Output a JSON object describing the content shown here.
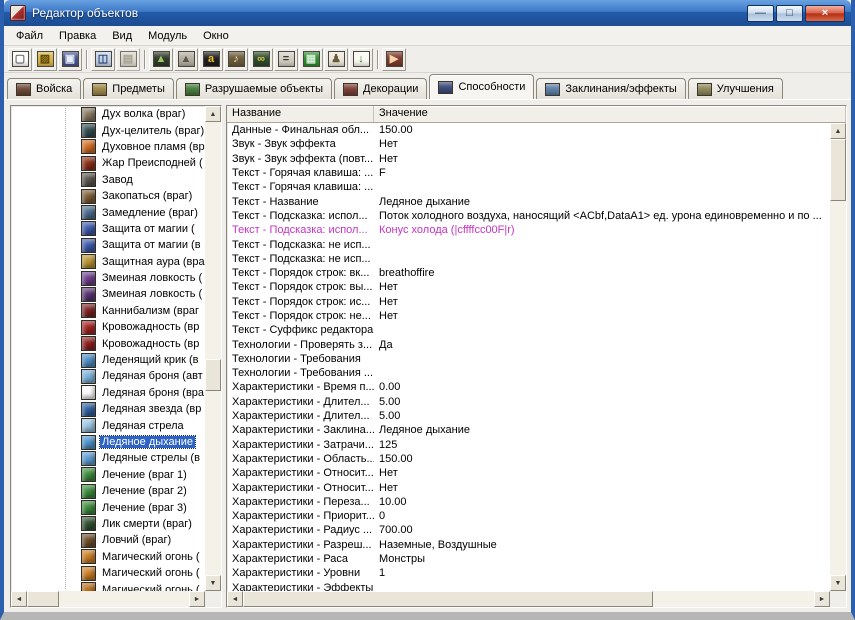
{
  "window": {
    "title": "Редактор объектов"
  },
  "window_buttons": {
    "minimize": "—",
    "maximize": "□",
    "close": "×"
  },
  "scroll_icons": {
    "up": "▲",
    "down": "▼",
    "left": "◄",
    "right": "►"
  },
  "menu": {
    "items": [
      "Файл",
      "Правка",
      "Вид",
      "Модуль",
      "Окно"
    ]
  },
  "toolbar": {
    "buttons": [
      {
        "name": "new-map-button",
        "glyph": "▢",
        "bg": "#ffffff",
        "fg": "#666666"
      },
      {
        "name": "open-map-button",
        "glyph": "▨",
        "bg": "#d8b44a",
        "fg": "#5a4400"
      },
      {
        "name": "save-map-button",
        "glyph": "▣",
        "bg": "#46548c",
        "fg": "#e8eef8"
      },
      {
        "class": "sep"
      },
      {
        "name": "copy-button",
        "glyph": "◫",
        "bg": "#c4d2e6",
        "fg": "#2c4a78"
      },
      {
        "name": "paste-button",
        "glyph": "▤",
        "bg": "#d4cfc0",
        "fg": "#8c8678",
        "class": "disabled"
      },
      {
        "class": "sep"
      },
      {
        "name": "terrain-editor-button",
        "glyph": "▲",
        "bg": "#2e3a28",
        "fg": "#9ec468"
      },
      {
        "name": "doodad-palette-button",
        "glyph": "▲",
        "bg": "#b2aea0",
        "fg": "#5c584c"
      },
      {
        "name": "trigger-editor-button",
        "glyph": "a",
        "bg": "#1e1e1e",
        "fg": "#f0c030"
      },
      {
        "name": "sound-editor-button",
        "glyph": "♪",
        "bg": "#6a5a3a",
        "fg": "#f4e6b0"
      },
      {
        "name": "object-editor-button",
        "glyph": "∞",
        "bg": "#2a4a2a",
        "fg": "#e2c444"
      },
      {
        "name": "object-manager-button",
        "glyph": "=",
        "bg": "#d2cec2",
        "fg": "#3a3a3a"
      },
      {
        "name": "campaign-editor-button",
        "glyph": "▦",
        "bg": "#2e8b2e",
        "fg": "#d2ecd2"
      },
      {
        "name": "ai-editor-button",
        "glyph": "♟",
        "bg": "#ece8dc",
        "fg": "#6a5a38"
      },
      {
        "name": "import-manager-button",
        "glyph": "↓",
        "bg": "#fafaf2",
        "fg": "#2a7a2a"
      },
      {
        "class": "sep"
      },
      {
        "name": "test-map-button",
        "glyph": "▶",
        "bg": "#7a382a",
        "fg": "#f4d6a8"
      }
    ]
  },
  "tabs": {
    "items": [
      {
        "name": "tab-units",
        "label": "Войска",
        "icon": "#6a4634"
      },
      {
        "name": "tab-items",
        "label": "Предметы",
        "icon": "#9a8446"
      },
      {
        "name": "tab-destructibles",
        "label": "Разрушаемые объекты",
        "icon": "#44783a"
      },
      {
        "name": "tab-doodads",
        "label": "Декорации",
        "icon": "#7a3c34"
      },
      {
        "name": "tab-abilities",
        "label": "Способности",
        "icon": "#3c4a78",
        "class": "active"
      },
      {
        "name": "tab-buffs",
        "label": "Заклинания/эффекты",
        "icon": "#5a7ca4"
      },
      {
        "name": "tab-upgrades",
        "label": "Улучшения",
        "icon": "#8a8456"
      }
    ]
  },
  "tree": {
    "items": [
      {
        "label": "Дух волка (враг)",
        "icon": "#87765f"
      },
      {
        "label": "Дух-целитель (враг)",
        "icon": "#2e4a4e"
      },
      {
        "label": "Духовное пламя (вр",
        "icon": "#d06a20"
      },
      {
        "label": "Жар Преисподней (",
        "icon": "#8a2a14"
      },
      {
        "label": "Завод",
        "icon": "#56524a"
      },
      {
        "label": "Закопаться (враг)",
        "icon": "#7a5a32"
      },
      {
        "label": "Замедление (враг)",
        "icon": "#4a6a8c"
      },
      {
        "label": "Защита от магии (",
        "icon": "#3a56a8"
      },
      {
        "label": "Защита от магии (в",
        "icon": "#3a56a8"
      },
      {
        "label": "Защитная аура (вра",
        "icon": "#b8922e"
      },
      {
        "label": "Змеиная ловкость (",
        "icon": "#6a3a8a"
      },
      {
        "label": "Змеиная ловкость (",
        "icon": "#553070"
      },
      {
        "label": "Каннибализм (враг",
        "icon": "#7a1e1e"
      },
      {
        "label": "Кровожадность (вр",
        "icon": "#a02020"
      },
      {
        "label": "Кровожадность (вр",
        "icon": "#8a1c1c"
      },
      {
        "label": "Леденящий крик (в",
        "icon": "#4a8ac2"
      },
      {
        "label": "Ледяная броня (авт",
        "icon": "#7ab0d8"
      },
      {
        "label": "Ледяная броня (вра",
        "icon": "#6aa4cе"
      },
      {
        "label": "Ледяная звезда (вр",
        "icon": "#2e5c9e"
      },
      {
        "label": "Ледяная стрела",
        "icon": "#9ac4e2"
      },
      {
        "label": "Ледяное дыхание",
        "icon": "#4a90c8",
        "class": "selected"
      },
      {
        "label": "Ледяные стрелы (в",
        "icon": "#5a9ad2"
      },
      {
        "label": "Лечение (враг 1)",
        "icon": "#3a8a3a"
      },
      {
        "label": "Лечение (враг 2)",
        "icon": "#3a8a3a"
      },
      {
        "label": "Лечение (враг 3)",
        "icon": "#3a8a3a"
      },
      {
        "label": "Лик смерти (враг)",
        "icon": "#2e4e2e"
      },
      {
        "label": "Ловчий (враг)",
        "icon": "#6a4a28"
      },
      {
        "label": "Магический огонь (",
        "icon": "#c87c20"
      },
      {
        "label": "Магический огонь (",
        "icon": "#c87c20"
      },
      {
        "label": "Магический огонь (",
        "icon": "#b86e1c"
      }
    ]
  },
  "table": {
    "columns": {
      "name": "Название",
      "value": "Значение"
    },
    "rows": [
      {
        "name": "Данные - Финальная обл...",
        "value": "150.00"
      },
      {
        "name": "Звук - Звук эффекта",
        "value": "Нет"
      },
      {
        "name": "Звук - Звук эффекта (повт...",
        "value": "Нет"
      },
      {
        "name": "Текст - Горячая клавиша: ...",
        "value": "F"
      },
      {
        "name": "Текст - Горячая клавиша: ...",
        "value": ""
      },
      {
        "name": "Текст - Название",
        "value": "Ледяное дыхание"
      },
      {
        "name": "Текст - Подсказка: испол...",
        "value": "Поток холодного воздуха, наносящий <ACbf,DataA1> ед. урона единовременно и по ..."
      },
      {
        "name": "Текст - Подсказка: испол...",
        "value": "Конус холода (|cffffcc00F|r)",
        "class": "modified"
      },
      {
        "name": "Текст - Подсказка: не исп...",
        "value": ""
      },
      {
        "name": "Текст - Подсказка: не исп...",
        "value": ""
      },
      {
        "name": "Текст - Порядок строк: вк...",
        "value": "breathoffire"
      },
      {
        "name": "Текст - Порядок строк: вы...",
        "value": "Нет"
      },
      {
        "name": "Текст - Порядок строк: ис...",
        "value": "Нет"
      },
      {
        "name": "Текст - Порядок строк: не...",
        "value": "Нет"
      },
      {
        "name": "Текст - Суффикс редактора",
        "value": ""
      },
      {
        "name": "Технологии - Проверять з...",
        "value": "Да"
      },
      {
        "name": "Технологии - Требования",
        "value": ""
      },
      {
        "name": "Технологии - Требования ...",
        "value": ""
      },
      {
        "name": "Характеристики - Время п...",
        "value": "0.00"
      },
      {
        "name": "Характеристики - Длител...",
        "value": "5.00"
      },
      {
        "name": "Характеристики - Длител...",
        "value": "5.00"
      },
      {
        "name": "Характеристики - Заклина...",
        "value": "Ледяное дыхание"
      },
      {
        "name": "Характеристики - Затрачи...",
        "value": "125"
      },
      {
        "name": "Характеристики - Область...",
        "value": "150.00"
      },
      {
        "name": "Характеристики - Относит...",
        "value": "Нет"
      },
      {
        "name": "Характеристики - Относит...",
        "value": "Нет"
      },
      {
        "name": "Характеристики - Переза...",
        "value": "10.00"
      },
      {
        "name": "Характеристики - Приорит...",
        "value": "0"
      },
      {
        "name": "Характеристики - Радиус ...",
        "value": "700.00"
      },
      {
        "name": "Характеристики - Разреш...",
        "value": "Наземные, Воздушные"
      },
      {
        "name": "Характеристики - Раса",
        "value": "Монстры"
      },
      {
        "name": "Характеристики - Уровни",
        "value": "1"
      },
      {
        "name": "Характеристики - Эффекты",
        "value": ""
      }
    ]
  }
}
